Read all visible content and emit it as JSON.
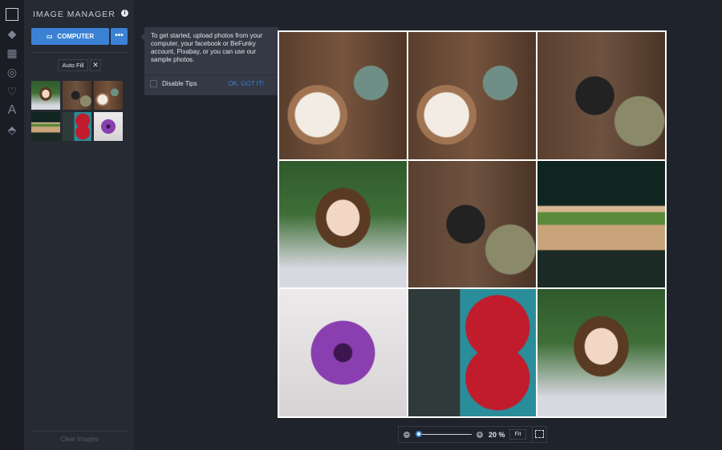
{
  "rail": {
    "icons": [
      "image-icon",
      "brush-icon",
      "grid-icon",
      "circle-icon",
      "heart-icon",
      "text-icon",
      "texture-icon"
    ]
  },
  "panel": {
    "title": "IMAGE MANAGER",
    "computer_label": "COMPUTER",
    "more_label": "•••",
    "auto_fill": "Auto Fill",
    "close": "✕",
    "clear": "Clear Images"
  },
  "tip": {
    "text": "To get started, upload photos from your computer, your facebook or BeFunky account, Pixabay, or you can use our sample photos.",
    "disable": "Disable Tips",
    "ok": "OK, GOT IT!"
  },
  "zoom": {
    "minus": "−",
    "plus": "+",
    "percent": "20 %",
    "fit": "Fit",
    "value": 20
  }
}
